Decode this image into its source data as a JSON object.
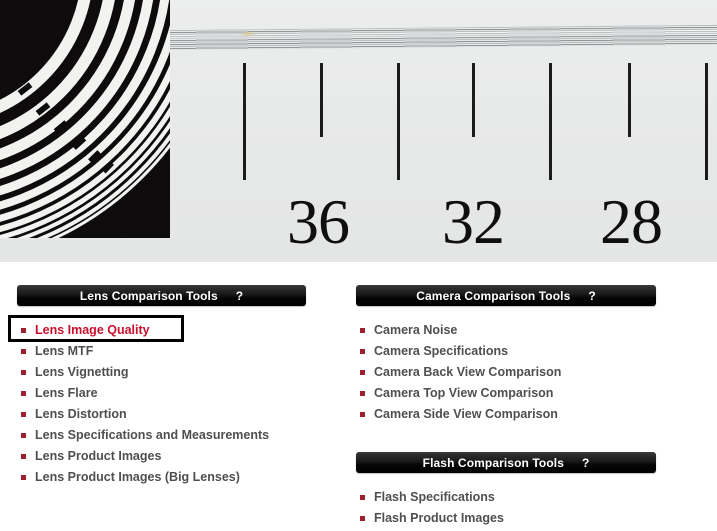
{
  "chart_image": {
    "description": "Lens resolution test chart photograph",
    "siemens_pattern": "concentric-arcs",
    "ruler_numbers": [
      "36",
      "32",
      "28"
    ],
    "tick_pattern": [
      "long",
      "short",
      "long",
      "short",
      "long",
      "short",
      "long"
    ]
  },
  "panels": [
    {
      "id": "lens",
      "header": {
        "title": "Lens Comparison Tools",
        "help": "?"
      },
      "items": [
        {
          "label": "Lens Image Quality",
          "selected": true
        },
        {
          "label": "Lens MTF",
          "selected": false
        },
        {
          "label": "Lens Vignetting",
          "selected": false
        },
        {
          "label": "Lens Flare",
          "selected": false
        },
        {
          "label": "Lens Distortion",
          "selected": false
        },
        {
          "label": "Lens Specifications and Measurements",
          "selected": false
        },
        {
          "label": "Lens Product Images",
          "selected": false
        },
        {
          "label": "Lens Product Images (Big Lenses)",
          "selected": false
        }
      ]
    },
    {
      "id": "camera",
      "header": {
        "title": "Camera Comparison Tools",
        "help": "?"
      },
      "items": [
        {
          "label": "Camera Noise",
          "selected": false
        },
        {
          "label": "Camera Specifications",
          "selected": false
        },
        {
          "label": "Camera Back View Comparison",
          "selected": false
        },
        {
          "label": "Camera Top View Comparison",
          "selected": false
        },
        {
          "label": "Camera Side View Comparison",
          "selected": false
        }
      ]
    },
    {
      "id": "flash",
      "header": {
        "title": "Flash Comparison Tools",
        "help": "?"
      },
      "items": [
        {
          "label": "Flash Specifications",
          "selected": false
        },
        {
          "label": "Flash Product Images",
          "selected": false
        }
      ]
    }
  ],
  "colors": {
    "selected_text": "#c8102e",
    "item_text": "#4f4f4f",
    "bullet": "#a02030",
    "header_bg": "#000000",
    "header_text": "#ffffff",
    "highlight_border": "#000000"
  }
}
